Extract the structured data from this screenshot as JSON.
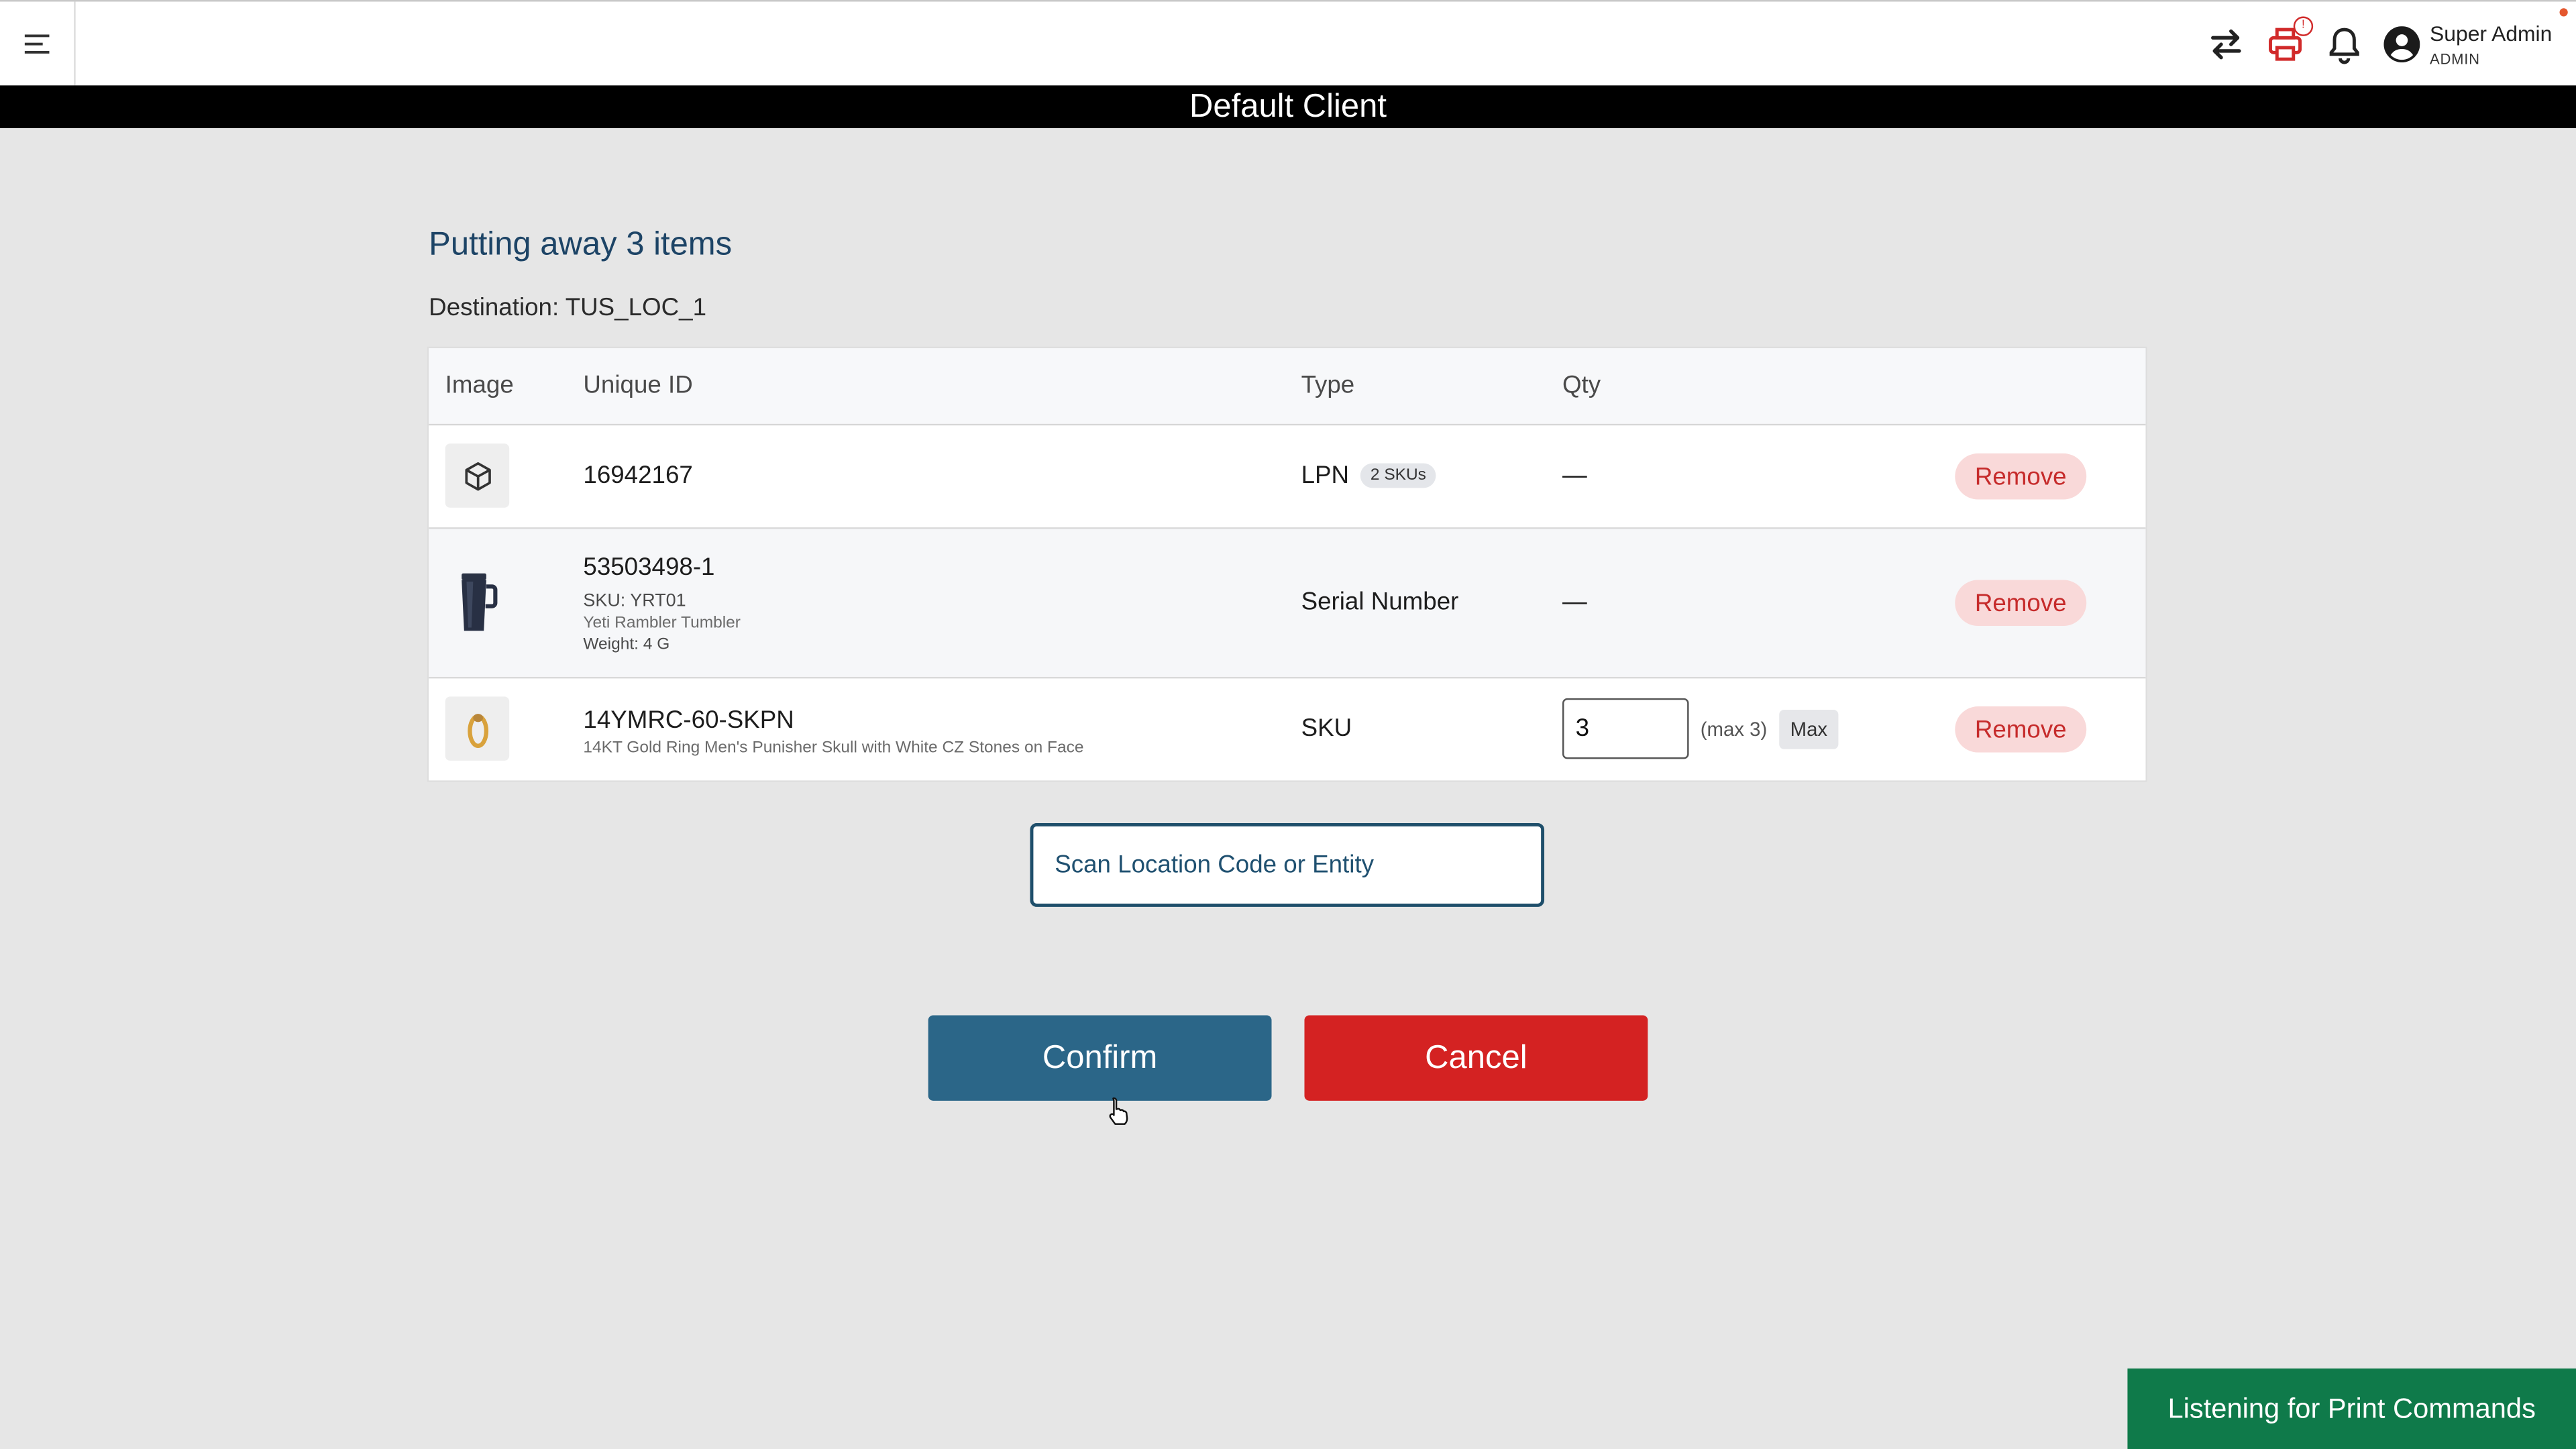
{
  "user": {
    "name": "Super Admin",
    "role": "ADMIN"
  },
  "client_banner": "Default Client",
  "page": {
    "title": "Putting away 3 items",
    "destination_label": "Destination: TUS_LOC_1"
  },
  "table": {
    "headers": {
      "image": "Image",
      "unique_id": "Unique ID",
      "type": "Type",
      "qty": "Qty"
    },
    "rows": [
      {
        "unique_id": "16942167",
        "type": "LPN",
        "chip": "2 SKUs",
        "qty": "—",
        "remove_label": "Remove",
        "image_icon": "box-icon"
      },
      {
        "unique_id": "53503498-1",
        "sku_line": "SKU: YRT01",
        "name": "Yeti Rambler Tumbler",
        "weight": "Weight: 4 G",
        "type": "Serial Number",
        "qty": "—",
        "remove_label": "Remove",
        "image_icon": "tumbler-icon"
      },
      {
        "unique_id": "14YMRC-60-SKPN",
        "name": "14KT Gold Ring Men's Punisher Skull with White CZ Stones on Face",
        "type": "SKU",
        "qty_value": "3",
        "max_hint": "(max 3)",
        "max_button": "Max",
        "remove_label": "Remove",
        "image_icon": "ring-icon"
      }
    ]
  },
  "scan": {
    "placeholder": "Scan Location Code or Entity"
  },
  "actions": {
    "confirm": "Confirm",
    "cancel": "Cancel"
  },
  "toast": "Listening for Print Commands",
  "icons": {
    "menu": "menu-icon",
    "transfer": "swap-arrows-icon",
    "printer": "printer-icon",
    "printer_badge": "!",
    "notifications": "bell-icon",
    "account": "account-circle-icon"
  },
  "colors": {
    "accent": "#2b6688",
    "danger": "#d42222",
    "toast": "#0f7a4a",
    "banner": "#000000",
    "title": "#1d4466"
  }
}
